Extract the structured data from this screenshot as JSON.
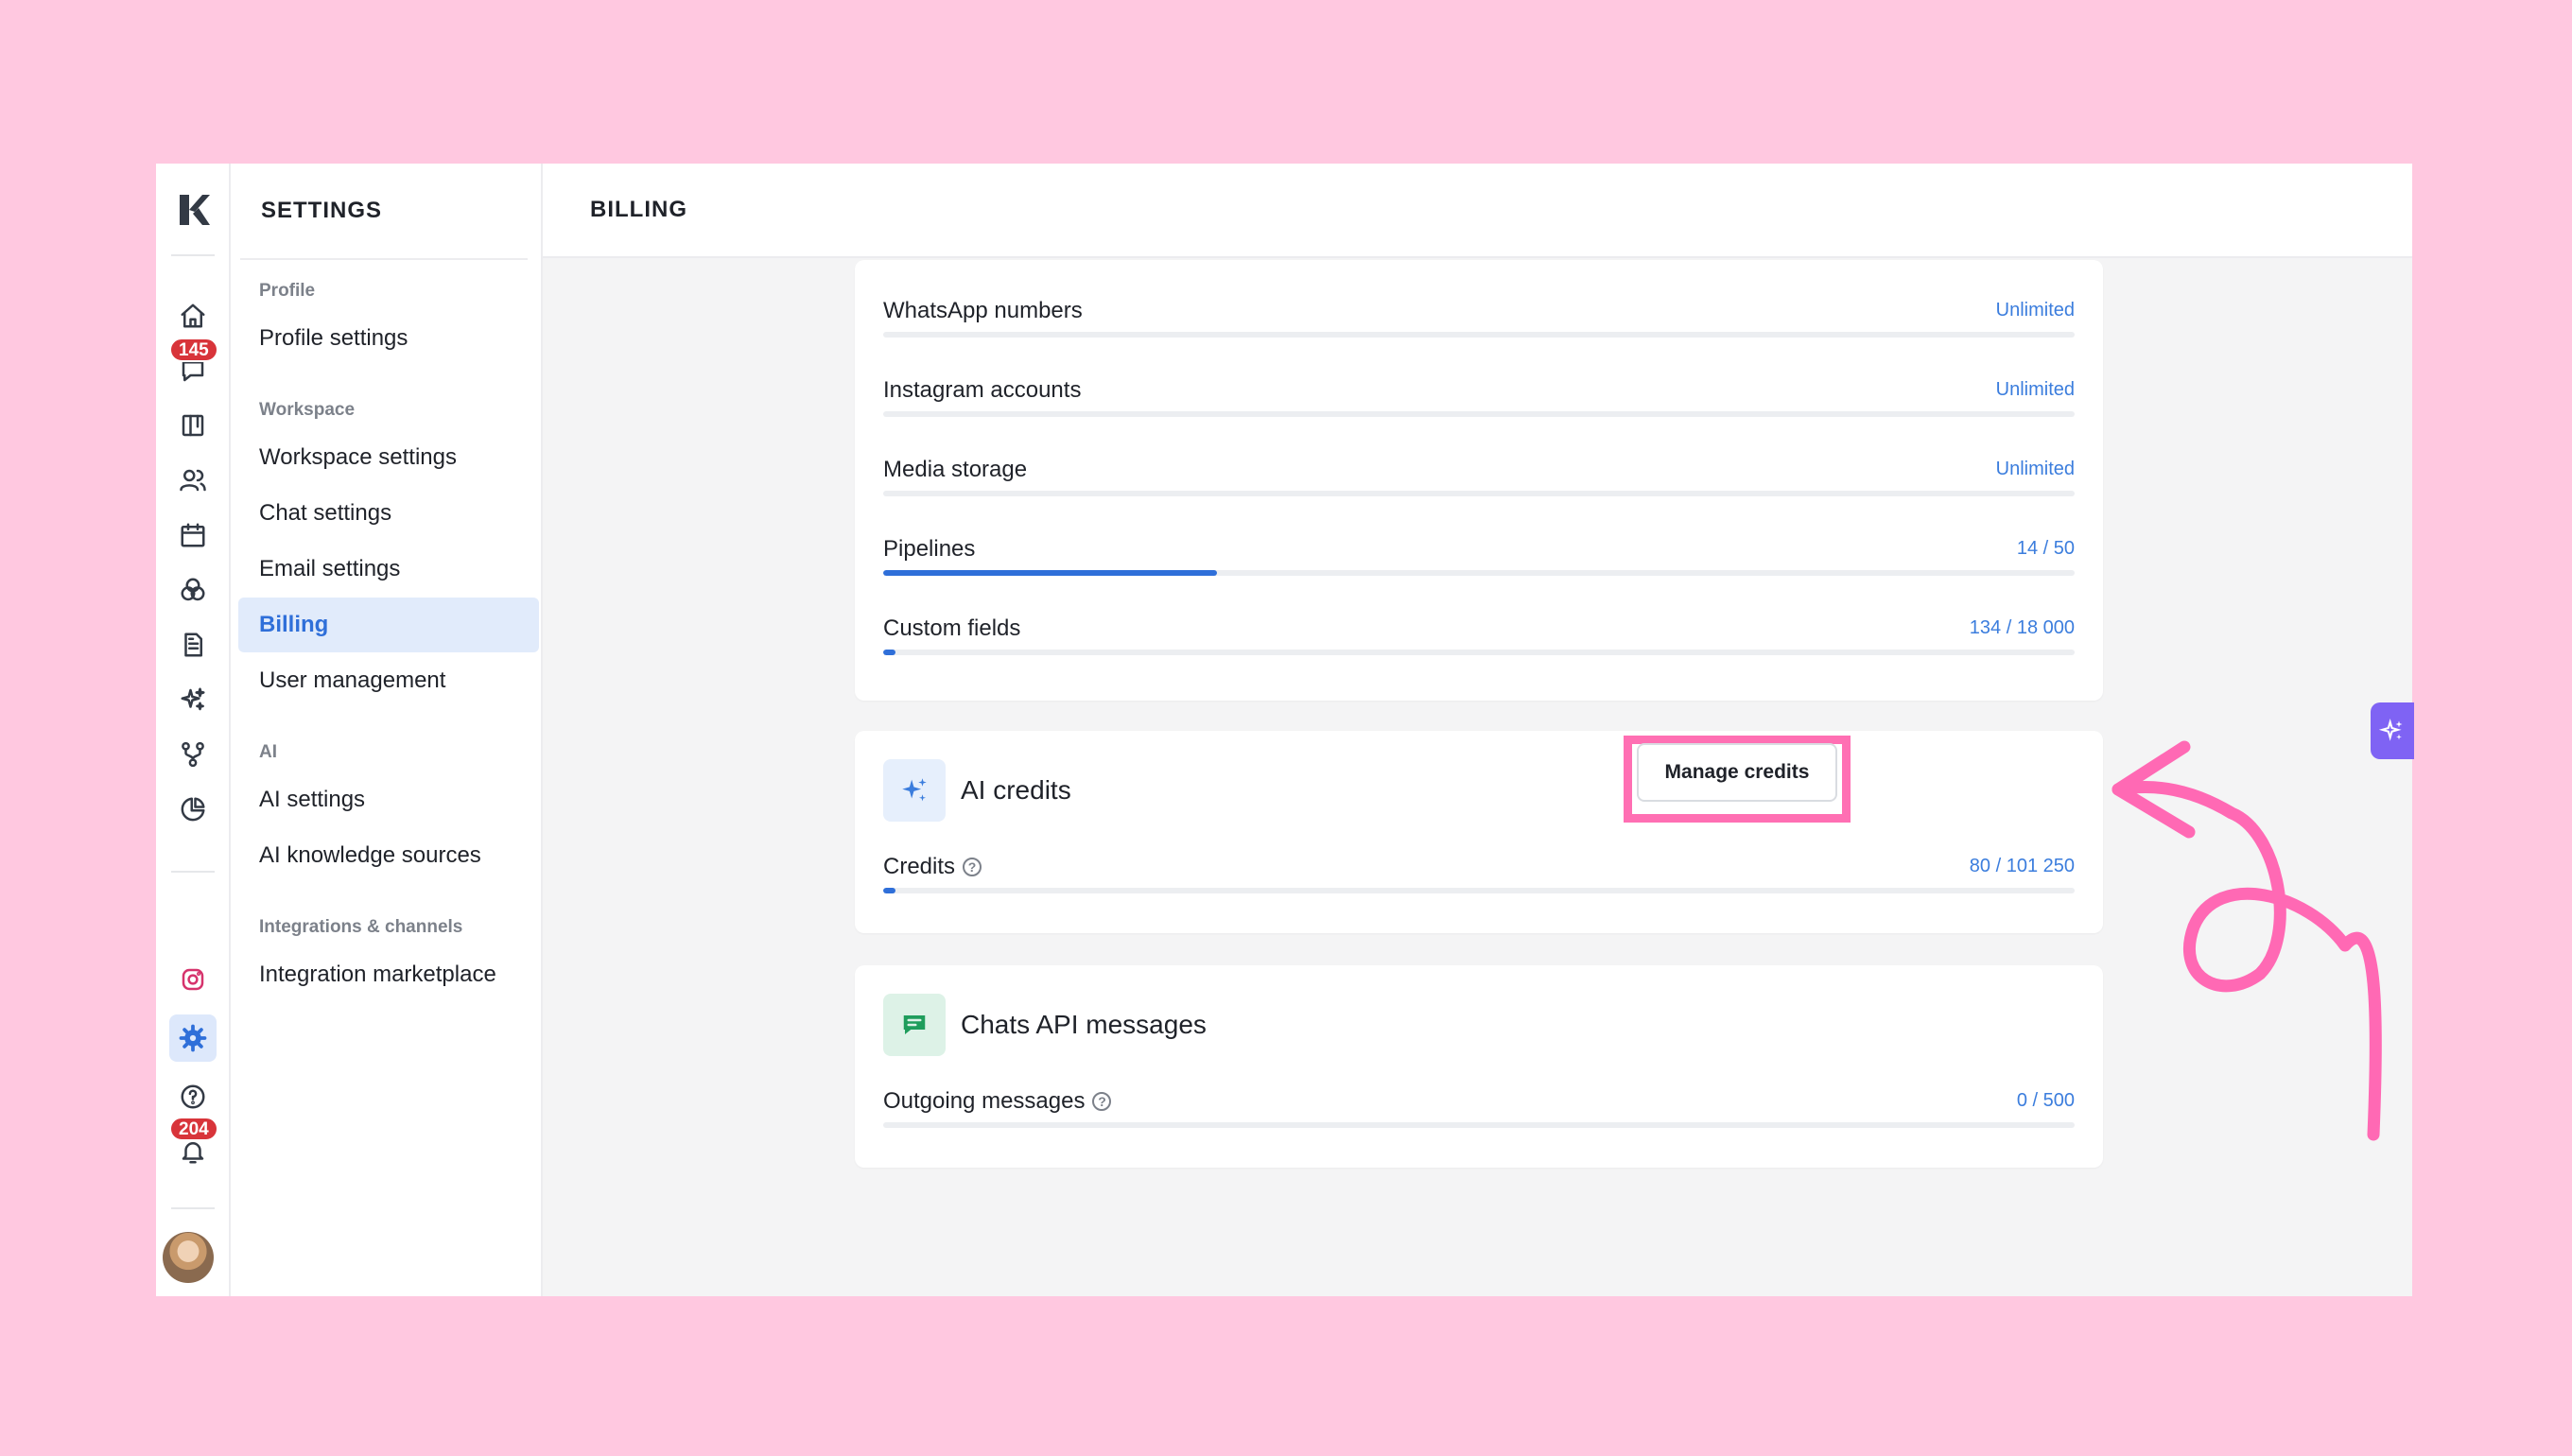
{
  "rail": {
    "badges": {
      "chats": "145",
      "notifications": "204"
    }
  },
  "settings": {
    "title": "SETTINGS",
    "sections": {
      "profile": "Profile",
      "workspace": "Workspace",
      "ai": "AI",
      "integrations": "Integrations & channels"
    },
    "items": {
      "profile_settings": "Profile settings",
      "workspace_settings": "Workspace settings",
      "chat_settings": "Chat settings",
      "email_settings": "Email settings",
      "billing": "Billing",
      "user_management": "User management",
      "ai_settings": "AI settings",
      "ai_knowledge_sources": "AI knowledge sources",
      "integration_marketplace": "Integration marketplace"
    }
  },
  "page": {
    "title": "BILLING"
  },
  "limits": [
    {
      "label": "WhatsApp numbers",
      "value": "Unlimited",
      "fraction": 0
    },
    {
      "label": "Instagram accounts",
      "value": "Unlimited",
      "fraction": 0
    },
    {
      "label": "Media storage",
      "value": "Unlimited",
      "fraction": 0
    },
    {
      "label": "Pipelines",
      "value": "14 / 50",
      "fraction": 0.28
    },
    {
      "label": "Custom fields",
      "value": "134 / 18 000",
      "fraction": 0.0074
    }
  ],
  "ai_credits": {
    "title": "AI credits",
    "button": "Manage credits",
    "row_label": "Credits",
    "row_value": "80 / 101 250",
    "fraction": 0.0008
  },
  "chats_api": {
    "title": "Chats API messages",
    "row_label": "Outgoing messages",
    "row_value": "0 / 500",
    "fraction": 0
  },
  "colors": {
    "accent": "#2f6fd9",
    "highlight": "#ff6fb3",
    "background": "#ffc8e0",
    "ai_fab": "#7f63f4"
  }
}
